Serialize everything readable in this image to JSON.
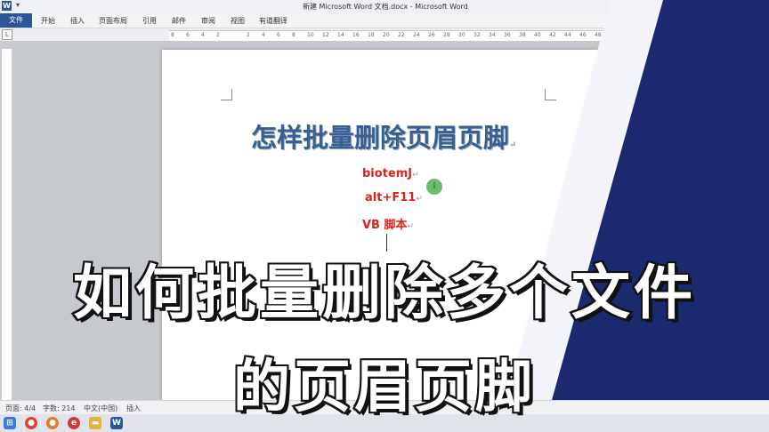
{
  "window": {
    "title": "新建 Microsoft Word 文档.docx - Microsoft Word",
    "app_icon_letter": "W",
    "quick_access": "▾"
  },
  "ribbon": {
    "tabs": [
      "文件",
      "开始",
      "插入",
      "页面布局",
      "引用",
      "邮件",
      "审阅",
      "视图",
      "有道翻译"
    ]
  },
  "ruler": {
    "corner": "L",
    "ticks": [
      "8",
      "6",
      "4",
      "2",
      "",
      "2",
      "4",
      "6",
      "8",
      "10",
      "12",
      "14",
      "16",
      "18",
      "20",
      "22",
      "24",
      "26",
      "28",
      "30",
      "32",
      "34",
      "36",
      "38",
      "40",
      "42",
      "44",
      "46",
      "48"
    ]
  },
  "document": {
    "title": "怎样批量删除页眉页脚",
    "lines": [
      "biotemJ",
      "alt+F11",
      "VB 脚本"
    ],
    "para_mark": "↵",
    "cursor_icon": "I"
  },
  "overlay": {
    "line1": "如何批量删除多个文件",
    "line2": "的页眉页脚"
  },
  "status": {
    "page": "页面: 4/4",
    "words": "字数: 214",
    "lang": "中文(中国)",
    "mode": "插入"
  },
  "taskbar": {
    "icons": [
      "windows-start-icon",
      "chrome-icon",
      "firefox-icon",
      "explorer-icon",
      "folder-icon",
      "word-icon"
    ]
  }
}
